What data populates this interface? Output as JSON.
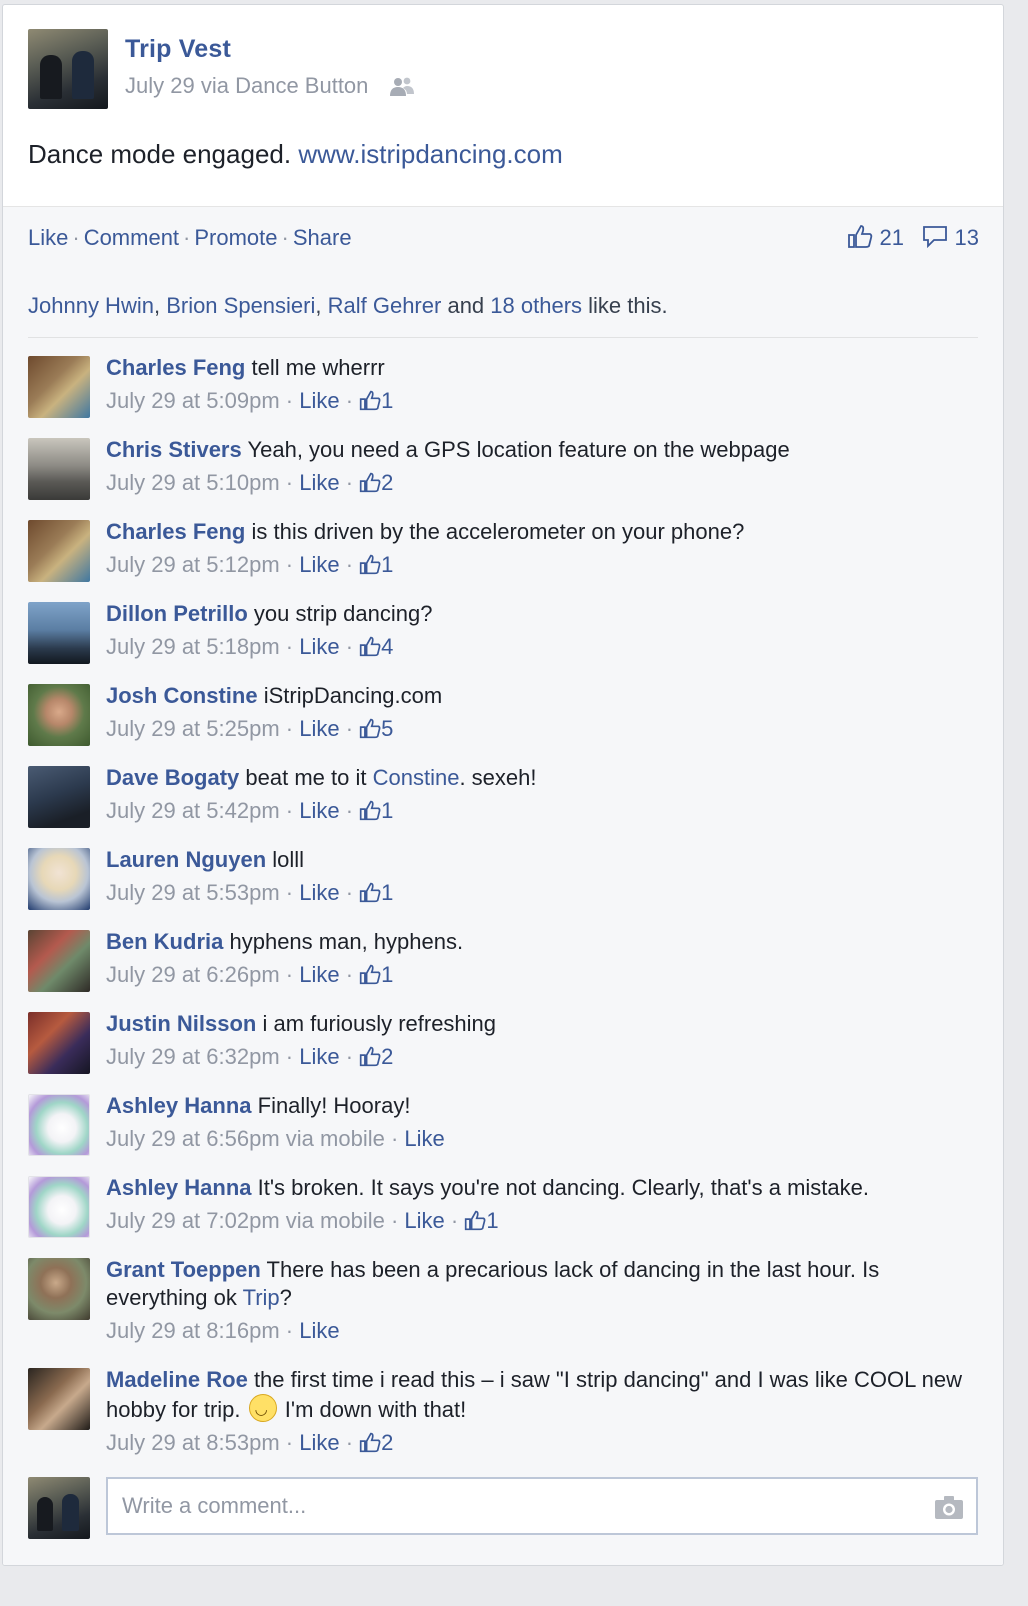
{
  "post": {
    "author": "Trip Vest",
    "date": "July 29",
    "via_prefix": "via",
    "app": "Dance Button",
    "text": "Dance mode engaged.",
    "link": "www.istripdancing.com",
    "audience_icon": "friends-icon"
  },
  "actions": {
    "like": "Like",
    "comment": "Comment",
    "promote": "Promote",
    "share": "Share",
    "separator": "·"
  },
  "counts": {
    "likes": "21",
    "comments": "13"
  },
  "likers": {
    "names": [
      "Johnny Hwin",
      "Brion Spensieri",
      "Ralf Gehrer"
    ],
    "and_text": "and",
    "others": "18 others",
    "suffix": "like this."
  },
  "comments": [
    {
      "name": "Charles Feng",
      "text": "tell me wherrr",
      "time": "July 29 at 5:09pm",
      "via": "",
      "like": "Like",
      "likes": "1"
    },
    {
      "name": "Chris Stivers",
      "text": "Yeah, you need a GPS location feature on the webpage",
      "time": "July 29 at 5:10pm",
      "via": "",
      "like": "Like",
      "likes": "2"
    },
    {
      "name": "Charles Feng",
      "text": "is this driven by the accelerometer on your phone?",
      "time": "July 29 at 5:12pm",
      "via": "",
      "like": "Like",
      "likes": "1"
    },
    {
      "name": "Dillon Petrillo",
      "text": "you strip dancing?",
      "time": "July 29 at 5:18pm",
      "via": "",
      "like": "Like",
      "likes": "4"
    },
    {
      "name": "Josh Constine",
      "text": "iStripDancing.com",
      "time": "July 29 at 5:25pm",
      "via": "",
      "like": "Like",
      "likes": "5"
    },
    {
      "name": "Dave Bogaty",
      "text_before": "beat me to it",
      "text_link": "Constine",
      "text_after": ". sexeh!",
      "time": "July 29 at 5:42pm",
      "via": "",
      "like": "Like",
      "likes": "1"
    },
    {
      "name": "Lauren Nguyen",
      "text": "lolll",
      "time": "July 29 at 5:53pm",
      "via": "",
      "like": "Like",
      "likes": "1"
    },
    {
      "name": "Ben Kudria",
      "text": "hyphens man, hyphens.",
      "time": "July 29 at 6:26pm",
      "via": "",
      "like": "Like",
      "likes": "1"
    },
    {
      "name": "Justin Nilsson",
      "text": "i am furiously refreshing",
      "time": "July 29 at 6:32pm",
      "via": "",
      "like": "Like",
      "likes": "2"
    },
    {
      "name": "Ashley Hanna",
      "text": "Finally! Hooray!",
      "time": "July 29 at 6:56pm",
      "via": "via mobile",
      "like": "Like",
      "likes": ""
    },
    {
      "name": "Ashley Hanna",
      "text": "It's broken. It says you're not dancing. Clearly, that's a mistake.",
      "time": "July 29 at 7:02pm",
      "via": "via mobile",
      "like": "Like",
      "likes": "1"
    },
    {
      "name": "Grant Toeppen",
      "text_before": "There has been a precarious lack of dancing in the last hour. Is everything ok",
      "text_link": "Trip",
      "text_after": "?",
      "time": "July 29 at 8:16pm",
      "via": "",
      "like": "Like",
      "likes": ""
    },
    {
      "name": "Madeline Roe",
      "text_before": "the first time i read this – i saw \"I strip dancing\" and I was like COOL new hobby for trip.",
      "emoji": "smile-emoji",
      "text_after": "I'm down with that!",
      "time": "July 29 at 8:53pm",
      "via": "",
      "like": "Like",
      "likes": "2"
    }
  ],
  "composer": {
    "placeholder": "Write a comment...",
    "value": "",
    "camera_icon": "camera-icon"
  },
  "colors": {
    "link": "#3b5998",
    "meta": "#9197a3",
    "text": "#1d2129",
    "ufi_bg": "#f6f7f9"
  }
}
